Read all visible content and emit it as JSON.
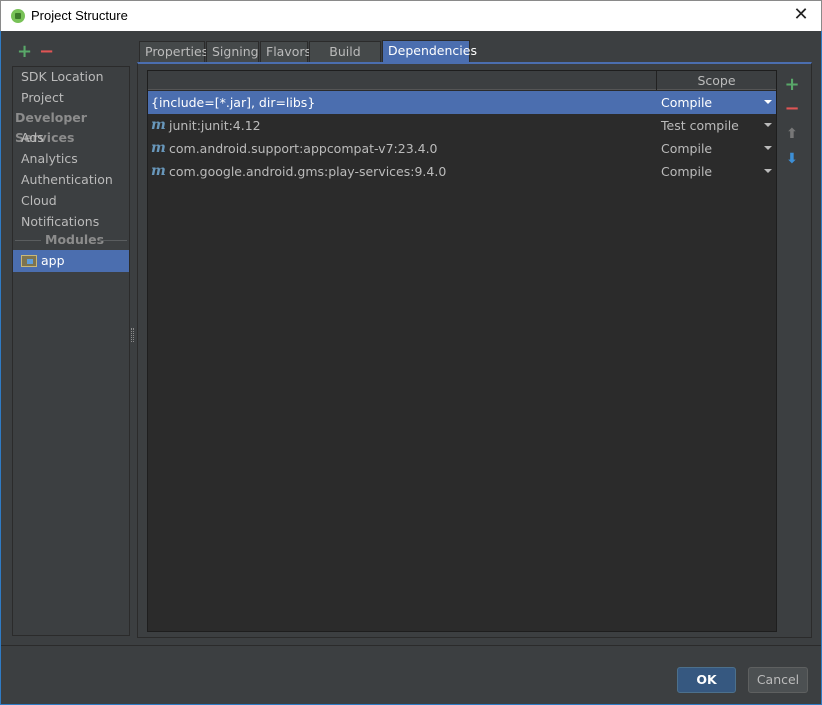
{
  "window": {
    "title": "Project Structure"
  },
  "left_panel": {
    "items": [
      {
        "label": "SDK Location"
      },
      {
        "label": "Project"
      }
    ],
    "developer_services_header": "Developer Services",
    "developer_services": [
      {
        "label": "Ads"
      },
      {
        "label": "Analytics"
      },
      {
        "label": "Authentication"
      },
      {
        "label": "Cloud"
      },
      {
        "label": "Notifications"
      }
    ],
    "modules_header": "Modules",
    "modules": [
      {
        "label": "app",
        "selected": true
      }
    ]
  },
  "tabs": [
    {
      "label": "Properties"
    },
    {
      "label": "Signing"
    },
    {
      "label": "Flavors"
    },
    {
      "label": "Build Types"
    },
    {
      "label": "Dependencies",
      "active": true
    }
  ],
  "dependencies": {
    "scope_header": "Scope",
    "rows": [
      {
        "name": "{include=[*.jar], dir=libs}",
        "scope": "Compile",
        "maven": false,
        "selected": true
      },
      {
        "name": "junit:junit:4.12",
        "scope": "Test compile",
        "maven": true,
        "selected": false
      },
      {
        "name": "com.android.support:appcompat-v7:23.4.0",
        "scope": "Compile",
        "maven": true,
        "selected": false
      },
      {
        "name": "com.google.android.gms:play-services:9.4.0",
        "scope": "Compile",
        "maven": true,
        "selected": false
      }
    ]
  },
  "icons": {
    "add": "plus-icon",
    "remove": "minus-icon",
    "move_up": "arrow-up-icon",
    "move_down": "arrow-down-icon",
    "maven": "maven-m-icon"
  },
  "buttons": {
    "ok": "OK",
    "cancel": "Cancel"
  },
  "colors": {
    "selection": "#4b6eaf",
    "add": "#59a869",
    "remove": "#e05555",
    "ok_button": "#365880"
  }
}
